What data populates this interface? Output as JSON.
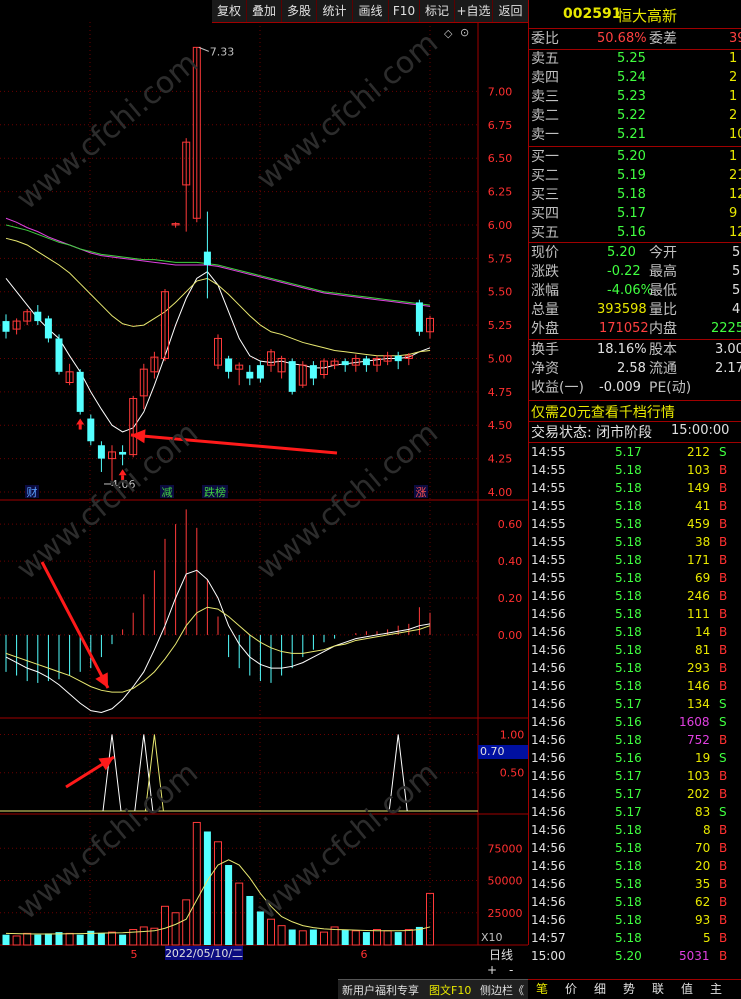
{
  "toolbar": {
    "buttons": [
      "复权",
      "叠加",
      "多股",
      "统计",
      "画线",
      "F10",
      "标记",
      "+自选",
      "返回"
    ]
  },
  "quote": {
    "code": "002591",
    "name": "恒大高新",
    "weibi_label": "委比",
    "weibi_value": "50.68%",
    "weicha_label": "委差",
    "weicha_value": "39",
    "asks": [
      {
        "label": "卖五",
        "price": "5.25",
        "vol": "1"
      },
      {
        "label": "卖四",
        "price": "5.24",
        "vol": "2"
      },
      {
        "label": "卖三",
        "price": "5.23",
        "vol": "1"
      },
      {
        "label": "卖二",
        "price": "5.22",
        "vol": "2"
      },
      {
        "label": "卖一",
        "price": "5.21",
        "vol": "10"
      }
    ],
    "bids": [
      {
        "label": "买一",
        "price": "5.20",
        "vol": "1"
      },
      {
        "label": "买二",
        "price": "5.19",
        "vol": "21"
      },
      {
        "label": "买三",
        "price": "5.18",
        "vol": "12"
      },
      {
        "label": "买四",
        "price": "5.17",
        "vol": "9"
      },
      {
        "label": "买五",
        "price": "5.16",
        "vol": "12"
      }
    ],
    "stats": [
      {
        "l1": "现价",
        "v1": "5.20",
        "l2": "今开",
        "v2": "5"
      },
      {
        "l1": "涨跌",
        "v1": "-0.22",
        "l2": "最高",
        "v2": "5"
      },
      {
        "l1": "涨幅",
        "v1": "-4.06%",
        "l2": "最低",
        "v2": "5"
      },
      {
        "l1": "总量",
        "v1": "393598",
        "l2": "量比",
        "v2": "4"
      },
      {
        "l1": "外盘",
        "v1": "171052",
        "l2": "内盘",
        "v2": "2225"
      }
    ],
    "stats2": [
      {
        "l1": "换手",
        "v1": "18.16%",
        "l2": "股本",
        "v2": "3.00"
      },
      {
        "l1": "净资",
        "v1": "2.58",
        "l2": "流通",
        "v2": "2.17"
      },
      {
        "l1": "收益(一)",
        "v1": "-0.009",
        "l2": "PE(动)",
        "v2": ""
      }
    ],
    "promo": "仅需20元查看千档行情",
    "trade_status_label": "交易状态: 闭市阶段",
    "trade_status_time": "15:00:00"
  },
  "ticks": [
    {
      "t": "14:55",
      "p": "5.17",
      "v": "212",
      "s": "S"
    },
    {
      "t": "14:55",
      "p": "5.18",
      "v": "103",
      "s": "B"
    },
    {
      "t": "14:55",
      "p": "5.18",
      "v": "149",
      "s": "B"
    },
    {
      "t": "14:55",
      "p": "5.18",
      "v": "41",
      "s": "B"
    },
    {
      "t": "14:55",
      "p": "5.18",
      "v": "459",
      "s": "B"
    },
    {
      "t": "14:55",
      "p": "5.18",
      "v": "38",
      "s": "B"
    },
    {
      "t": "14:55",
      "p": "5.18",
      "v": "171",
      "s": "B"
    },
    {
      "t": "14:55",
      "p": "5.18",
      "v": "69",
      "s": "B"
    },
    {
      "t": "14:56",
      "p": "5.18",
      "v": "246",
      "s": "B"
    },
    {
      "t": "14:56",
      "p": "5.18",
      "v": "111",
      "s": "B"
    },
    {
      "t": "14:56",
      "p": "5.18",
      "v": "14",
      "s": "B"
    },
    {
      "t": "14:56",
      "p": "5.18",
      "v": "81",
      "s": "B"
    },
    {
      "t": "14:56",
      "p": "5.18",
      "v": "293",
      "s": "B"
    },
    {
      "t": "14:56",
      "p": "5.18",
      "v": "146",
      "s": "B"
    },
    {
      "t": "14:56",
      "p": "5.17",
      "v": "134",
      "s": "S"
    },
    {
      "t": "14:56",
      "p": "5.16",
      "v": "1608",
      "s": "S"
    },
    {
      "t": "14:56",
      "p": "5.18",
      "v": "752",
      "s": "B"
    },
    {
      "t": "14:56",
      "p": "5.16",
      "v": "19",
      "s": "S"
    },
    {
      "t": "14:56",
      "p": "5.17",
      "v": "103",
      "s": "B"
    },
    {
      "t": "14:56",
      "p": "5.17",
      "v": "202",
      "s": "B"
    },
    {
      "t": "14:56",
      "p": "5.17",
      "v": "83",
      "s": "S"
    },
    {
      "t": "14:56",
      "p": "5.18",
      "v": "8",
      "s": "B"
    },
    {
      "t": "14:56",
      "p": "5.18",
      "v": "70",
      "s": "B"
    },
    {
      "t": "14:56",
      "p": "5.18",
      "v": "20",
      "s": "B"
    },
    {
      "t": "14:56",
      "p": "5.18",
      "v": "35",
      "s": "B"
    },
    {
      "t": "14:56",
      "p": "5.18",
      "v": "62",
      "s": "B"
    },
    {
      "t": "14:56",
      "p": "5.18",
      "v": "93",
      "s": "B"
    },
    {
      "t": "14:57",
      "p": "5.18",
      "v": "5",
      "s": "B"
    },
    {
      "t": "15:00",
      "p": "5.20",
      "v": "5031",
      "s": "B"
    }
  ],
  "bottom_tabs": [
    "笔",
    "价",
    "细",
    "势",
    "联",
    "值",
    "主"
  ],
  "status_bar": {
    "left": "新用户福利专享",
    "mid": "图文F10",
    "right": "侧边栏《"
  },
  "chart_side": {
    "period": "日线",
    "plus": "+",
    "minus": "-",
    "x10": "X10",
    "indicator_value": "0.70"
  },
  "chart_labels": {
    "high_label": "7.33",
    "low_label": "4.06",
    "date_label": "2022/05/10/二",
    "month5": "5",
    "month6": "6",
    "event_marks": [
      "财",
      "减",
      "跌榜",
      "涨"
    ],
    "watermark": "www.cfchi.com"
  },
  "chart_data": {
    "type": "candlestick",
    "price_axis_ticks": [
      "7.00",
      "6.75",
      "6.50",
      "6.25",
      "6.00",
      "5.75",
      "5.50",
      "5.25",
      "5.00",
      "4.75",
      "4.50",
      "4.25",
      "4.00"
    ],
    "price_range": [
      3.94,
      7.52
    ],
    "macd_axis_ticks": [
      "0.60",
      "0.40",
      "0.20",
      "0.00"
    ],
    "macd_range": [
      -0.45,
      0.72
    ],
    "ind_axis_ticks": [
      "1.00",
      "0.50"
    ],
    "ind_range": [
      0,
      1.15
    ],
    "vol_axis_ticks": [
      "75000",
      "50000",
      "25000"
    ],
    "vol_range": [
      0,
      100000
    ],
    "candles": [
      [
        5.28,
        5.2,
        5.33,
        5.15
      ],
      [
        5.22,
        5.28,
        5.3,
        5.18
      ],
      [
        5.28,
        5.35,
        5.37,
        5.25
      ],
      [
        5.35,
        5.28,
        5.4,
        5.25
      ],
      [
        5.3,
        5.15,
        5.32,
        5.12
      ],
      [
        5.15,
        4.9,
        5.18,
        4.88
      ],
      [
        4.82,
        4.9,
        4.96,
        4.8
      ],
      [
        4.9,
        4.6,
        4.92,
        4.58
      ],
      [
        4.55,
        4.38,
        4.58,
        4.35
      ],
      [
        4.35,
        4.25,
        4.38,
        4.15
      ],
      [
        4.25,
        4.3,
        4.35,
        4.06
      ],
      [
        4.3,
        4.28,
        4.35,
        4.2
      ],
      [
        4.28,
        4.7,
        4.72,
        4.26
      ],
      [
        4.72,
        4.92,
        4.96,
        4.62
      ],
      [
        4.9,
        5.01,
        5.05,
        4.85
      ],
      [
        5.0,
        5.5,
        5.52,
        4.98
      ],
      [
        6.0,
        6.01,
        6.02,
        5.98
      ],
      [
        6.3,
        6.62,
        6.65,
        5.95
      ],
      [
        6.05,
        7.33,
        7.33,
        6.02
      ],
      [
        5.8,
        5.7,
        6.1,
        5.45
      ],
      [
        4.95,
        5.15,
        5.18,
        4.92
      ],
      [
        5.0,
        4.9,
        5.02,
        4.85
      ],
      [
        4.92,
        4.95,
        4.97,
        4.8
      ],
      [
        4.9,
        4.85,
        4.95,
        4.8
      ],
      [
        4.95,
        4.85,
        4.98,
        4.82
      ],
      [
        4.95,
        5.05,
        5.07,
        4.9
      ],
      [
        4.9,
        5.0,
        5.02,
        4.85
      ],
      [
        4.98,
        4.75,
        5.0,
        4.73
      ],
      [
        4.8,
        4.95,
        4.98,
        4.78
      ],
      [
        4.95,
        4.85,
        4.98,
        4.8
      ],
      [
        4.88,
        4.98,
        5.0,
        4.85
      ],
      [
        4.95,
        4.98,
        5.0,
        4.92
      ],
      [
        4.98,
        4.95,
        5.0,
        4.9
      ],
      [
        4.95,
        5.0,
        5.03,
        4.9
      ],
      [
        5.0,
        4.95,
        5.02,
        4.9
      ],
      [
        4.95,
        5.0,
        5.02,
        4.9
      ],
      [
        4.98,
        5.02,
        5.05,
        4.95
      ],
      [
        5.02,
        4.98,
        5.05,
        4.92
      ],
      [
        5.0,
        5.02,
        5.04,
        4.95
      ],
      [
        5.42,
        5.2,
        5.44,
        5.17
      ],
      [
        5.2,
        5.3,
        5.32,
        5.15
      ]
    ],
    "ma_lines": [
      {
        "color": "#ffffff",
        "values": [
          5.6,
          5.5,
          5.4,
          5.3,
          5.22,
          5.15,
          5.02,
          4.9,
          4.75,
          4.62,
          4.5,
          4.45,
          4.48,
          4.6,
          4.8,
          5.02,
          5.25,
          5.45,
          5.6,
          5.65,
          5.55,
          5.35,
          5.15,
          5.02,
          4.98,
          4.97,
          4.98,
          4.96,
          4.95,
          4.93,
          4.93,
          4.95,
          4.96,
          4.97,
          4.98,
          4.99,
          5.0,
          5.0,
          5.01,
          5.05,
          5.08
        ]
      },
      {
        "color": "#e8e870",
        "values": [
          5.9,
          5.88,
          5.85,
          5.8,
          5.75,
          5.7,
          5.64,
          5.56,
          5.48,
          5.4,
          5.32,
          5.26,
          5.24,
          5.25,
          5.3,
          5.35,
          5.42,
          5.5,
          5.58,
          5.6,
          5.55,
          5.48,
          5.4,
          5.32,
          5.25,
          5.2,
          5.18,
          5.15,
          5.12,
          5.1,
          5.08,
          5.06,
          5.05,
          5.04,
          5.03,
          5.02,
          5.02,
          5.02,
          5.03,
          5.05,
          5.06
        ]
      },
      {
        "color": "#e040e0",
        "values": [
          6.05,
          6.02,
          5.98,
          5.95,
          5.91,
          5.88,
          5.85,
          5.82,
          5.79,
          5.77,
          5.76,
          5.75,
          5.74,
          5.73,
          5.72,
          5.71,
          5.7,
          5.7,
          5.7,
          5.7,
          5.69,
          5.67,
          5.65,
          5.63,
          5.61,
          5.59,
          5.57,
          5.55,
          5.53,
          5.51,
          5.49,
          5.48,
          5.47,
          5.46,
          5.45,
          5.44,
          5.43,
          5.42,
          5.41,
          5.4,
          5.39
        ]
      },
      {
        "color": "#40d040",
        "values": [
          6.0,
          5.98,
          5.96,
          5.93,
          5.9,
          5.87,
          5.85,
          5.82,
          5.8,
          5.78,
          5.77,
          5.76,
          5.75,
          5.74,
          5.74,
          5.73,
          5.72,
          5.72,
          5.72,
          5.71,
          5.7,
          5.68,
          5.66,
          5.64,
          5.62,
          5.6,
          5.58,
          5.56,
          5.54,
          5.52,
          5.5,
          5.49,
          5.48,
          5.47,
          5.46,
          5.45,
          5.44,
          5.43,
          5.42,
          5.41,
          5.4
        ]
      }
    ],
    "macd_bars": [
      -0.2,
      -0.22,
      -0.25,
      -0.26,
      -0.25,
      -0.24,
      -0.22,
      -0.2,
      -0.18,
      -0.12,
      -0.05,
      0.03,
      0.12,
      0.22,
      0.35,
      0.52,
      0.6,
      0.68,
      0.58,
      0.3,
      0.1,
      -0.12,
      -0.18,
      -0.22,
      -0.25,
      -0.26,
      -0.22,
      -0.18,
      -0.12,
      -0.08,
      -0.04,
      -0.02,
      0.0,
      0.01,
      0.02,
      0.02,
      0.03,
      0.05,
      0.06,
      0.15,
      0.12
    ],
    "macd_dif": [
      -0.12,
      -0.15,
      -0.18,
      -0.2,
      -0.23,
      -0.27,
      -0.32,
      -0.37,
      -0.41,
      -0.42,
      -0.4,
      -0.35,
      -0.28,
      -0.2,
      -0.08,
      0.05,
      0.2,
      0.33,
      0.35,
      0.3,
      0.2,
      0.05,
      -0.05,
      -0.12,
      -0.16,
      -0.18,
      -0.18,
      -0.17,
      -0.15,
      -0.12,
      -0.09,
      -0.06,
      -0.04,
      -0.02,
      -0.01,
      0.0,
      0.01,
      0.02,
      0.03,
      0.05,
      0.06
    ],
    "macd_dea": [
      -0.1,
      -0.12,
      -0.14,
      -0.16,
      -0.18,
      -0.2,
      -0.22,
      -0.25,
      -0.28,
      -0.3,
      -0.31,
      -0.31,
      -0.29,
      -0.25,
      -0.2,
      -0.13,
      -0.05,
      0.05,
      0.12,
      0.15,
      0.14,
      0.1,
      0.05,
      0.0,
      -0.04,
      -0.07,
      -0.09,
      -0.1,
      -0.1,
      -0.09,
      -0.08,
      -0.06,
      -0.05,
      -0.03,
      -0.02,
      -0.01,
      0.0,
      0.01,
      0.02,
      0.03,
      0.05
    ],
    "ind_peaks": [
      {
        "i": 10,
        "color": "#ffffff"
      },
      {
        "i": 13,
        "color": "#ffffff"
      },
      {
        "i": 14,
        "color": "#e8e870"
      },
      {
        "i": 37,
        "color": "#ffffff"
      }
    ],
    "volumes": [
      8000,
      7000,
      9000,
      8000,
      9000,
      10000,
      9000,
      8000,
      11000,
      9000,
      10000,
      8000,
      12000,
      14000,
      13000,
      30000,
      25000,
      35000,
      95000,
      88000,
      80000,
      62000,
      48000,
      38000,
      26000,
      20000,
      15000,
      12000,
      11000,
      12000,
      10000,
      14000,
      12000,
      11000,
      10000,
      12000,
      11000,
      10000,
      12000,
      14000,
      40000
    ],
    "vol_ma": [
      9000,
      8800,
      8600,
      8500,
      8500,
      8600,
      8700,
      8800,
      9000,
      9200,
      9400,
      9500,
      10000,
      10500,
      11000,
      13000,
      16000,
      20000,
      35000,
      50000,
      62000,
      66000,
      62000,
      52000,
      40000,
      30000,
      22000,
      18000,
      15000,
      13500,
      12500,
      12000,
      11800,
      11500,
      11200,
      11000,
      11000,
      11000,
      11200,
      12000,
      14000
    ]
  }
}
